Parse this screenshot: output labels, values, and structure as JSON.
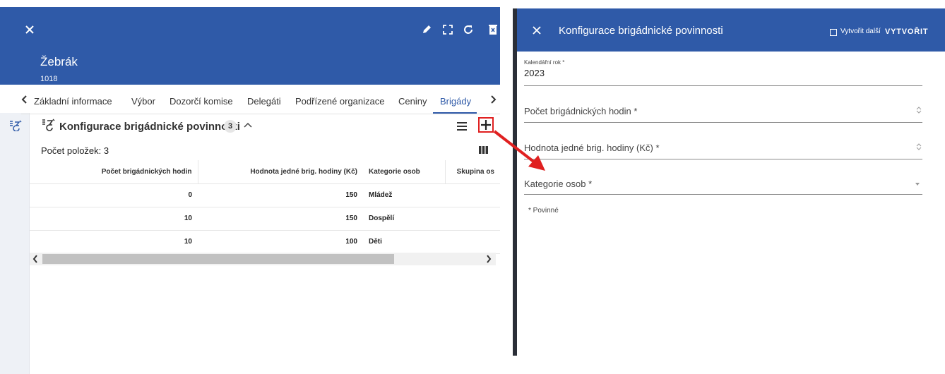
{
  "left": {
    "header": {
      "title": "Žebrák",
      "subtitle": "1018"
    },
    "tabs": [
      {
        "label": "Základní informace"
      },
      {
        "label": "Výbor"
      },
      {
        "label": "Dozorčí komise"
      },
      {
        "label": "Delegáti"
      },
      {
        "label": "Podřízené organizace"
      },
      {
        "label": "Ceniny"
      },
      {
        "label": "Brigády",
        "active": true
      }
    ],
    "section": {
      "title": "Konfigurace brigádnické povinnosti",
      "badge": "3",
      "items_count": "Počet položek: 3"
    },
    "table": {
      "columns": [
        "Počet brigádnických hodin",
        "Hodnota jedné brig. hodiny (Kč)",
        "Kategorie osob",
        "Skupina os"
      ],
      "rows": [
        [
          "0",
          "150",
          "Mládež",
          ""
        ],
        [
          "10",
          "150",
          "Dospělí",
          ""
        ],
        [
          "10",
          "100",
          "Děti",
          ""
        ]
      ]
    }
  },
  "right": {
    "header": {
      "title": "Konfigurace brigádnické povinnosti",
      "checkbox_label": "Vytvořit další",
      "create_label": "VYTVOŘIT"
    },
    "fields": {
      "year": {
        "label": "Kalendářní rok *",
        "value": "2023"
      },
      "hours": {
        "label": "Počet brigádnických hodin *"
      },
      "hour_value": {
        "label": "Hodnota jedné brig. hodiny (Kč) *"
      },
      "category": {
        "label": "Kategorie osob *"
      }
    },
    "required_note": "* Povinné"
  },
  "colors": {
    "primary": "#2f5aa8",
    "annotation": "#e02020"
  }
}
